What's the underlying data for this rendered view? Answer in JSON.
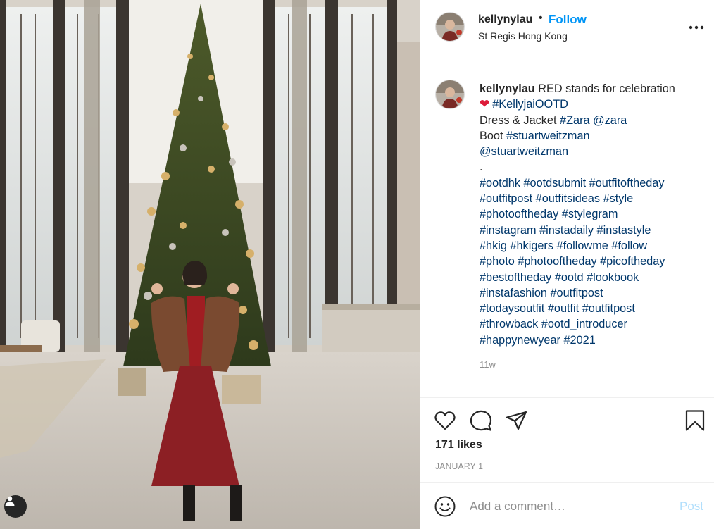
{
  "header": {
    "username": "kellynylau",
    "separator": "•",
    "follow_label": "Follow",
    "location": "St Regis Hong Kong"
  },
  "caption": {
    "username": "kellynylau",
    "first_text": "RED stands for celebration",
    "heart": "❤",
    "line2_tag": "#KellyjaiOOTD",
    "line3_text": "Dress & Jacket",
    "line3_tag1": "#Zara",
    "line3_tag2": "@zara",
    "line4_text": "Boot",
    "line4_tag": "#stuartweitzman",
    "line5_tag": "@stuartweitzman",
    "dot_line": ".",
    "hashtag_lines": [
      "#ootdhk #ootdsubmit #outfitoftheday",
      "#outfitpost #outfitsideas #style",
      "#photooftheday #stylegram",
      "#instagram #instadaily #instastyle",
      "#hkig #hkigers #followme #follow",
      "#photo #photooftheday #picoftheday",
      "#bestoftheday #ootd #lookbook",
      "#instafashion #outfitpost",
      "#todaysoutfit #outfit #outfitpost",
      "#throwback #ootd_introducer",
      "#happynewyear #2021"
    ]
  },
  "age": "11w",
  "likes": "171 likes",
  "date": "JANUARY 1",
  "comment": {
    "placeholder": "Add a comment…",
    "post_label": "Post"
  },
  "icons": {
    "like": "heart-outline-icon",
    "comment": "comment-bubble-icon",
    "share": "paper-plane-icon",
    "save": "bookmark-icon",
    "more": "more-horizontal-icon",
    "emoji": "smiley-icon",
    "user_tag": "person-icon"
  },
  "colors": {
    "link": "#0095f6",
    "hashtag": "#00376b",
    "secondary_text": "#8e8e8e",
    "post_disabled": "#b2dffc"
  }
}
